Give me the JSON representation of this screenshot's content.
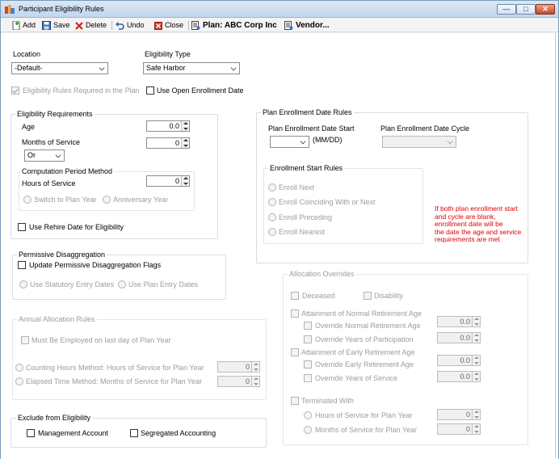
{
  "window": {
    "title": "Participant Eligibility Rules",
    "minimize": "—",
    "maximize": "□",
    "close": "✕"
  },
  "toolbar": {
    "add": "Add",
    "save": "Save",
    "delete": "Delete",
    "undo": "Undo",
    "close": "Close",
    "plan": "Plan: ABC Corp Inc",
    "vendor": "Vendor..."
  },
  "location": {
    "label": "Location",
    "value": "-Default-"
  },
  "eligibility_type": {
    "label": "Eligibility Type",
    "value": "Safe Harbor"
  },
  "rules_required": {
    "label": "Eligibility Rules Required in the Plan",
    "checked": true
  },
  "use_open_enrollment": {
    "label": "Use Open Enrollment Date"
  },
  "eligibility_requirements": {
    "title": "Eligibility Requirements",
    "age_label": "Age",
    "age_value": "0.0",
    "months_label": "Months of Service",
    "months_value": "0",
    "or_value": "Or",
    "computation": {
      "title": "Computation Period Method",
      "hours_label": "Hours of Service",
      "hours_value": "0",
      "switch_label": "Switch to Plan Year",
      "anniversary_label": "Anniversary Year"
    },
    "rehire_label": "Use Rehire Date for Eligibility"
  },
  "permissive": {
    "title": "Permissive Disaggregation",
    "update_label": "Update Permissive Disaggregation Flags",
    "statutory_label": "Use Statutory Entry Dates",
    "plan_entry_label": "Use Plan Entry Dates"
  },
  "annual": {
    "title": "Annual Allocation Rules",
    "must_label": "Must Be Employed on last day of Plan Year",
    "counting_label": "Counting Hours Method:  Hours of Service for Plan Year",
    "counting_value": "0",
    "elapsed_label": "Elapsed Time Method: Months of Service for Plan Year",
    "elapsed_value": "0"
  },
  "exclude": {
    "title": "Exclude from Eligibility",
    "management_label": "Management Account",
    "segregated_label": "Segregated Accounting"
  },
  "plan_enrollment": {
    "title": "Plan Enrollment Date Rules",
    "start_label": "Plan Enrollment Date Start",
    "format_hint": "(MM/DD)",
    "cycle_label": "Plan Enrollment Date Cycle",
    "start_rules": {
      "title": "Enrollment Start Rules",
      "options": [
        "Enroll Next",
        "Enroll Coinciding With or Next",
        "Enroll Preceding",
        "Enroll Nearest"
      ]
    },
    "note": [
      "If both plan enrollment start",
      "and cycle are blank,",
      "enrollment date will be",
      "the date the age and service",
      "requirements are met"
    ]
  },
  "allocation_overrides": {
    "title": "Allocation Overrides",
    "deceased": "Deceased",
    "disability": "Disability",
    "normal": {
      "label": "Attainment of Normal Retirement Age",
      "override_age": "Override Normal Retirement Age",
      "override_age_value": "0.0",
      "override_years": "Override Years of Participation",
      "override_years_value": "0.0"
    },
    "early": {
      "label": "Attainment of Early Retirement Age",
      "override_age": "Override Early Retirement Age",
      "override_age_value": "0.0",
      "override_years": "Override Years of Service",
      "override_years_value": "0.0"
    },
    "terminated": {
      "label": "Terminated With",
      "hours": "Hours of Service for Plan Year",
      "hours_value": "0",
      "months": "Months of Service for Plan Year",
      "months_value": "0"
    }
  },
  "colors": {
    "note": "#e00000",
    "disabled": "#9c9c9c"
  }
}
